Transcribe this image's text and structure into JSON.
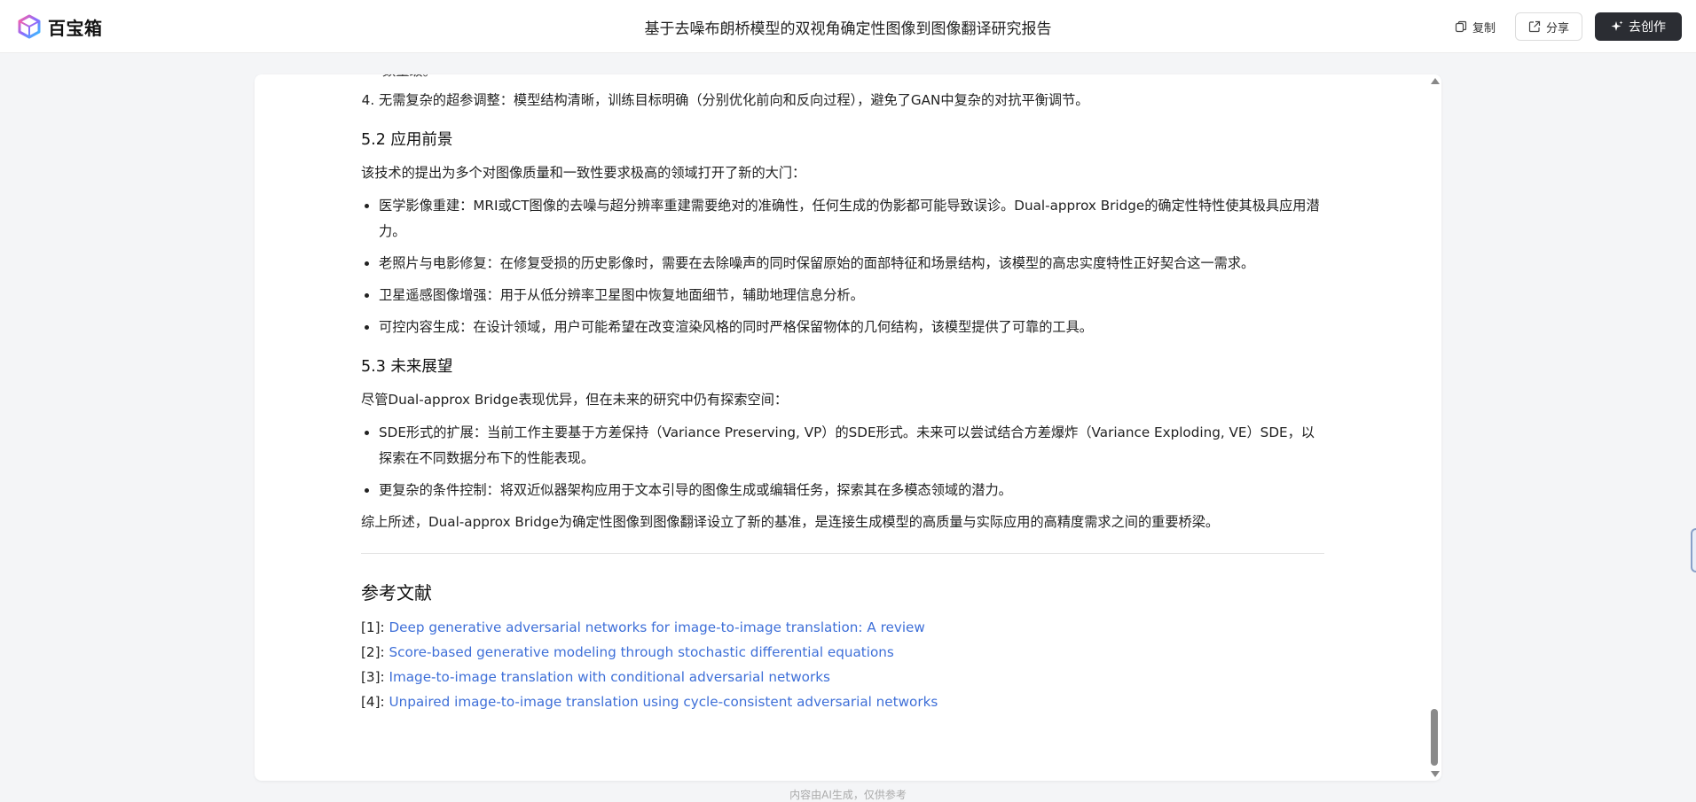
{
  "header": {
    "brand": "百宝箱",
    "title": "基于去噪布朗桥模型的双视角确定性图像到图像翻译研究报告",
    "copy_label": "复制",
    "share_label": "分享",
    "create_label": "去创作"
  },
  "content": {
    "partial_prev_line": "数量级。",
    "ol_items": [
      "无需复杂的超参调整：模型结构清晰，训练目标明确（分别优化前向和反向过程），避免了GAN中复杂的对抗平衡调节。"
    ],
    "ol_start": 4,
    "s52": {
      "heading": "5.2 应用前景",
      "intro": "该技术的提出为多个对图像质量和一致性要求极高的领域打开了新的大门：",
      "items": [
        "医学影像重建：MRI或CT图像的去噪与超分辨率重建需要绝对的准确性，任何生成的伪影都可能导致误诊。Dual-approx Bridge的确定性特性使其极具应用潜力。",
        "老照片与电影修复：在修复受损的历史影像时，需要在去除噪声的同时保留原始的面部特征和场景结构，该模型的高忠实度特性正好契合这一需求。",
        "卫星遥感图像增强：用于从低分辨率卫星图中恢复地面细节，辅助地理信息分析。",
        "可控内容生成：在设计领域，用户可能希望在改变渲染风格的同时严格保留物体的几何结构，该模型提供了可靠的工具。"
      ]
    },
    "s53": {
      "heading": "5.3 未来展望",
      "intro": "尽管Dual-approx Bridge表现优异，但在未来的研究中仍有探索空间：",
      "items": [
        "SDE形式的扩展：当前工作主要基于方差保持（Variance Preserving, VP）的SDE形式。未来可以尝试结合方差爆炸（Variance Exploding, VE）SDE，以探索在不同数据分布下的性能表现。",
        "更复杂的条件控制：将双近似器架构应用于文本引导的图像生成或编辑任务，探索其在多模态领域的潜力。"
      ],
      "conclusion": "综上所述，Dual-approx Bridge为确定性图像到图像翻译设立了新的基准，是连接生成模型的高质量与实际应用的高精度需求之间的重要桥梁。"
    },
    "references": {
      "heading": "参考文献",
      "items": [
        {
          "tag": "[1]: ",
          "title": "Deep generative adversarial networks for image-to-image translation: A review"
        },
        {
          "tag": "[2]: ",
          "title": "Score-based generative modeling through stochastic differential equations"
        },
        {
          "tag": "[3]: ",
          "title": "Image-to-image translation with conditional adversarial networks"
        },
        {
          "tag": "[4]: ",
          "title": "Unpaired image-to-image translation using cycle-consistent adversarial networks"
        }
      ]
    }
  },
  "footer": {
    "note": "内容由AI生成，仅供参考"
  },
  "colors": {
    "link": "#3e6fd8",
    "create_button_bg": "#2b2d33"
  }
}
